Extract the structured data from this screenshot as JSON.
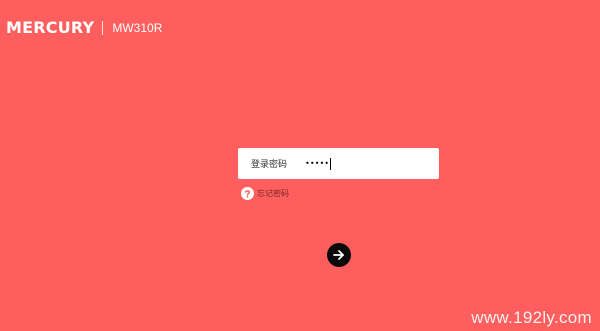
{
  "header": {
    "brand": "MERCURY",
    "model": "MW310R"
  },
  "login": {
    "label": "登录密码",
    "password_mask": "•••••"
  },
  "forgot": {
    "text": "忘记密码"
  },
  "watermark": {
    "text": "www.192ly.com"
  },
  "icons": {
    "help": "question-mark-icon",
    "submit": "arrow-right-icon"
  },
  "colors": {
    "background": "#fe5e5e",
    "submit_button": "#0a0a0a",
    "panel": "#ffffff"
  }
}
